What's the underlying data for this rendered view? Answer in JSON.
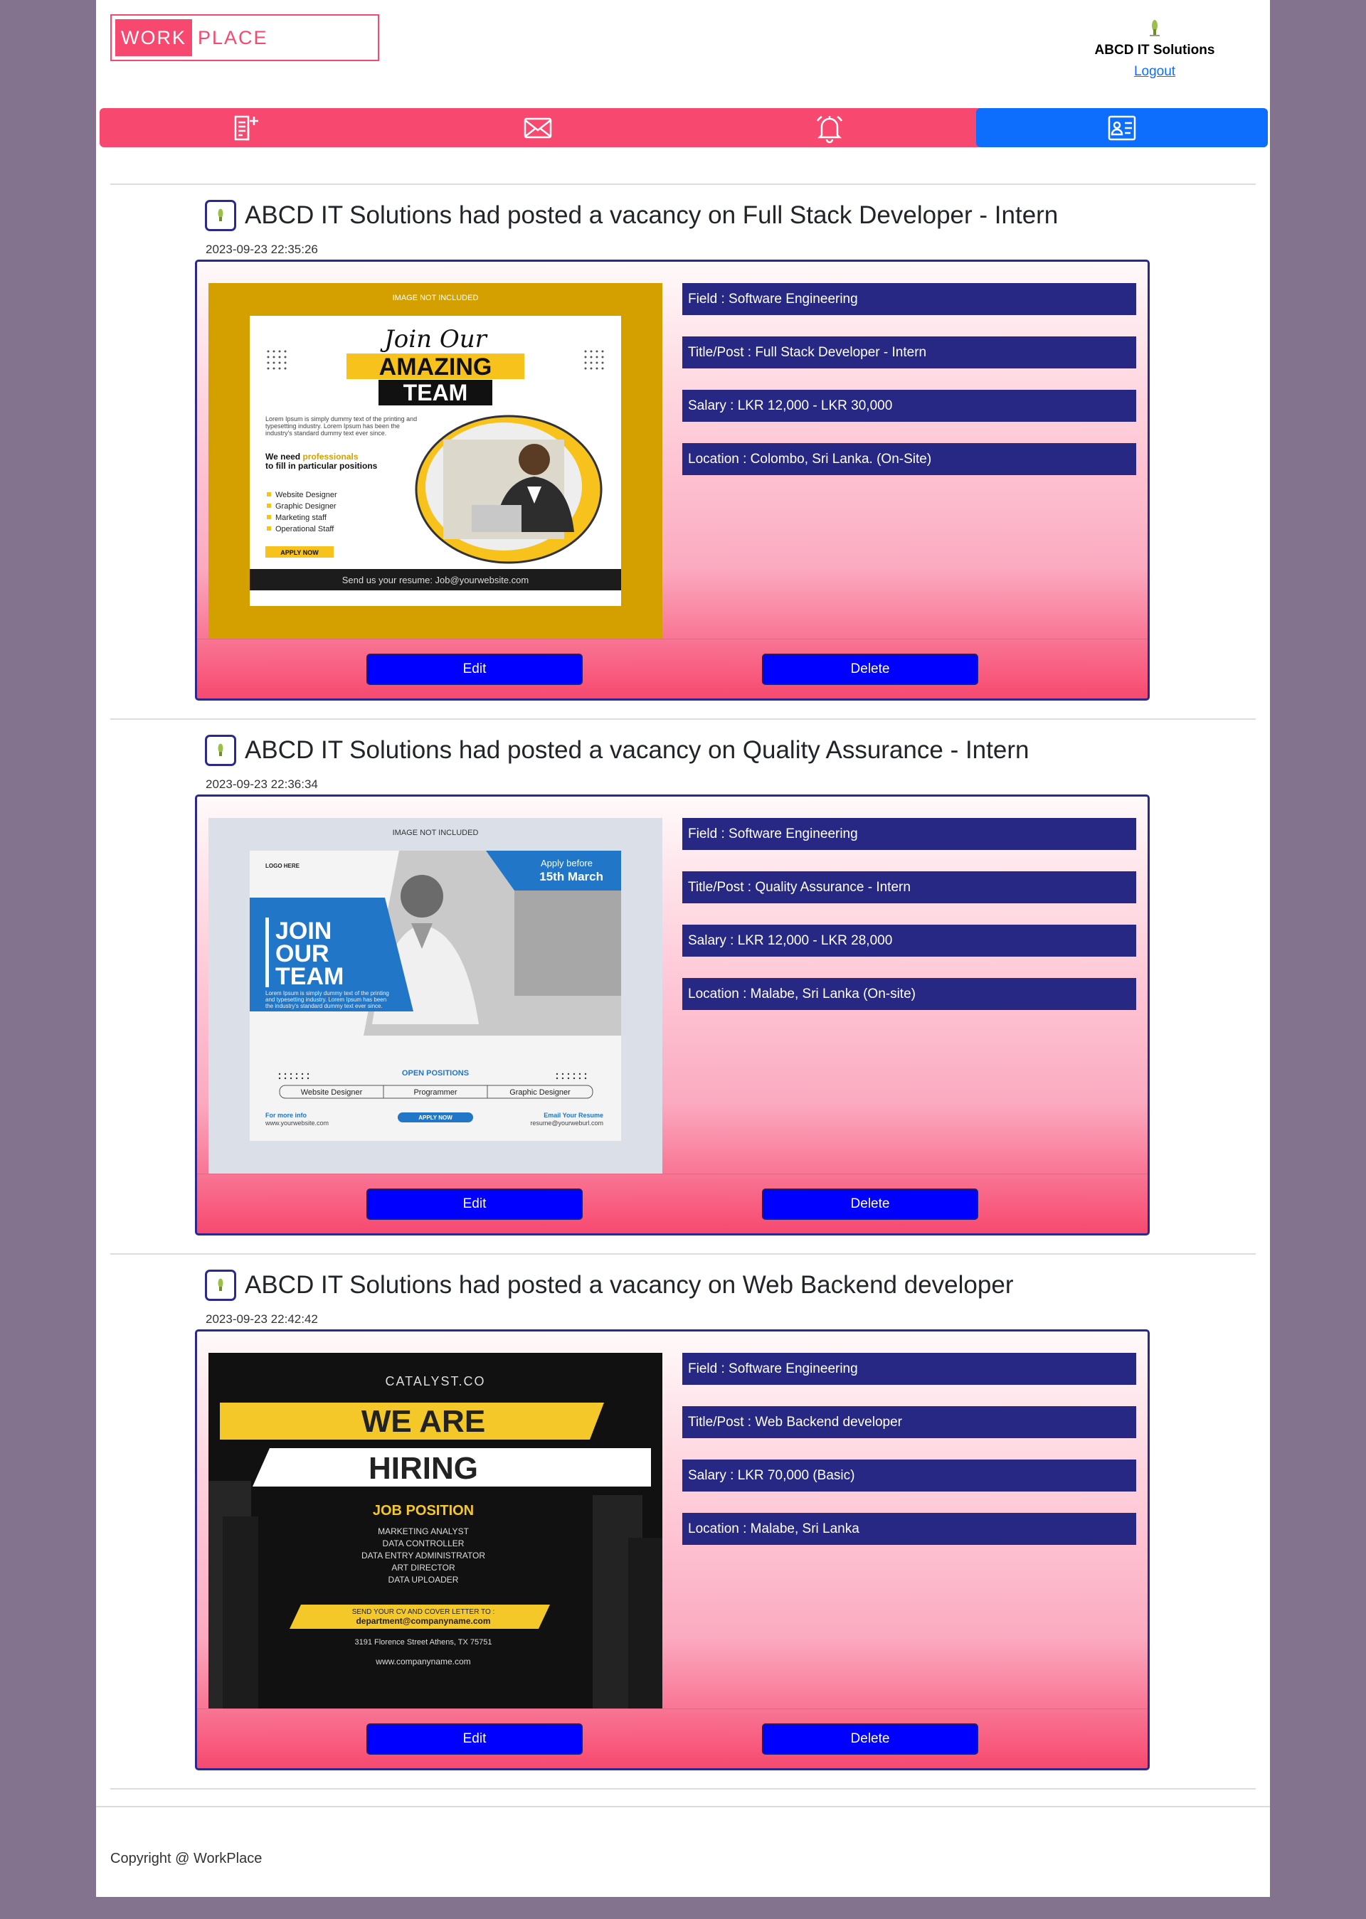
{
  "header": {
    "logo_part1": "WORK",
    "logo_part2": "PLACE",
    "company_name": "ABCD IT Solutions",
    "logout_label": "Logout"
  },
  "nav": {
    "items": [
      {
        "icon": "add-post-icon",
        "active": false
      },
      {
        "icon": "mail-icon",
        "active": false
      },
      {
        "icon": "bell-icon",
        "active": false
      },
      {
        "icon": "profile-card-icon",
        "active": true
      }
    ]
  },
  "colors": {
    "brand_pink": "#f7496f",
    "active_blue": "#0d6efd",
    "navy": "#262883",
    "button_blue": "#0000ff",
    "page_bg": "#84738f"
  },
  "posts": [
    {
      "title": "ABCD IT Solutions had posted a vacancy on Full Stack Developer - Intern",
      "date": "2023-09-23 22:35:26",
      "field": "Field : Software Engineering",
      "post": "Title/Post : Full Stack Developer - Intern",
      "salary": "Salary : LKR 12,000 - LKR 30,000",
      "location": "Location : Colombo, Sri Lanka. (On-Site)",
      "edit_label": "Edit",
      "delete_label": "Delete",
      "poster": {
        "top_note": "IMAGE NOT INCLUDED",
        "script": "Join Our",
        "line1": "AMAZING",
        "line2": "TEAM",
        "lorem": "Lorem Ipsum is simply dummy text of the printing and typesetting industry. Lorem Ipsum has been the industry's standard dummy text ever since.",
        "need_a": "We need ",
        "need_b": "professionals",
        "need_c": "to fill in particular positions",
        "positions": [
          "Website Designer",
          "Graphic Designer",
          "Marketing staff",
          "Operational Staff"
        ],
        "apply": "APPLY NOW",
        "footer": "Send us your resume: Job@yourwebsite.com"
      }
    },
    {
      "title": "ABCD IT Solutions had posted a vacancy on Quality Assurance - Intern",
      "date": "2023-09-23 22:36:34",
      "field": "Field : Software Engineering",
      "post": "Title/Post : Quality Assurance - Intern",
      "salary": "Salary : LKR 12,000 - LKR 28,000",
      "location": "Location : Malabe, Sri Lanka (On-site)",
      "edit_label": "Edit",
      "delete_label": "Delete",
      "poster": {
        "top_note": "IMAGE NOT INCLUDED",
        "logo": "LOGO HERE",
        "apply_before": "Apply before",
        "date": "15th March",
        "line1": "JOIN",
        "line2": "OUR",
        "line3": "TEAM",
        "lorem": "Lorem Ipsum is simply dummy text of the printing and typesetting industry. Lorem Ipsum has been the industry's standard dummy text ever since.",
        "open_positions": "OPEN POSITIONS",
        "positions": [
          "Website Designer",
          "Programmer",
          "Graphic Designer"
        ],
        "more_info": "For more info",
        "website": "www.yourwebsite.com",
        "apply": "APPLY NOW",
        "email_label": "Email Your Resume",
        "email": "resume@yourweburl.com"
      }
    },
    {
      "title": "ABCD IT Solutions had posted a vacancy on Web Backend developer",
      "date": "2023-09-23 22:42:42",
      "field": "Field : Software Engineering",
      "post": "Title/Post : Web Backend developer",
      "salary": "Salary : LKR 70,000 (Basic)",
      "location": "Location : Malabe, Sri Lanka",
      "edit_label": "Edit",
      "delete_label": "Delete",
      "poster": {
        "brand": "CATALYST.CO",
        "line1": "WE ARE",
        "line2": "HIRING",
        "job_position": "JOB POSITION",
        "positions": [
          "MARKETING ANALYST",
          "DATA CONTROLLER",
          "DATA ENTRY ADMINISTRATOR",
          "ART DIRECTOR",
          "DATA UPLOADER"
        ],
        "send_cv": "SEND YOUR CV AND COVER LETTER TO :",
        "email": "department@companyname.com",
        "address": "3191 Florence Street Athens, TX 75751",
        "website": "www.companyname.com"
      }
    }
  ],
  "footer": {
    "copyright": "Copyright @ WorkPlace"
  }
}
